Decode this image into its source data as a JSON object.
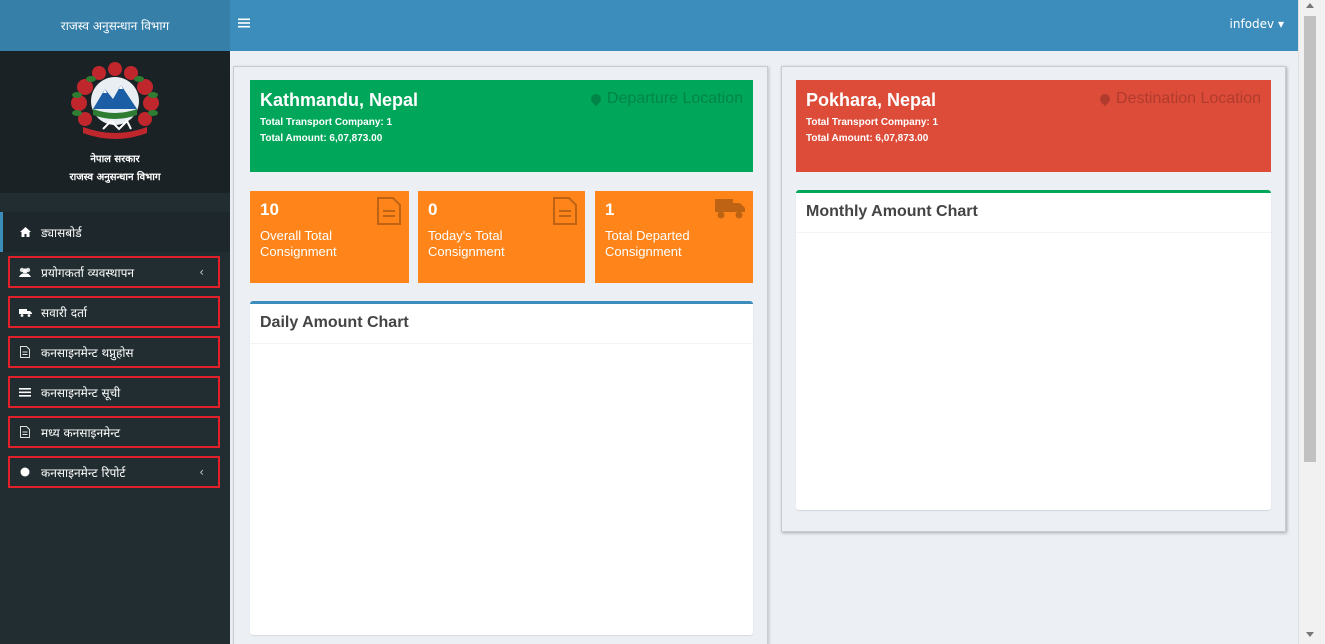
{
  "sidebar": {
    "brand": "राजस्व अनुसन्धान विभाग",
    "logo_line1": "नेपाल सरकार",
    "logo_line2": "राजस्व अनुसन्धान विभाग",
    "items": [
      {
        "label": "ड्यासबोर्ड",
        "icon": "home-icon"
      },
      {
        "label": "प्रयोगकर्ता व्यवस्थापन",
        "icon": "users-icon"
      },
      {
        "label": "सवारी दर्ता",
        "icon": "truck-icon"
      },
      {
        "label": "कनसाइनमेन्ट थप्नुहोस",
        "icon": "file-icon"
      },
      {
        "label": "कनसाइनमेन्ट सूची",
        "icon": "list-icon"
      },
      {
        "label": "मध्य कनसाइनमेन्ट",
        "icon": "file-icon"
      },
      {
        "label": "कनसाइनमेन्ट रिपोर्ट",
        "icon": "circle-icon"
      }
    ]
  },
  "navbar": {
    "user": "infodev ▾"
  },
  "departure": {
    "city": "Kathmandu, Nepal",
    "label": "Departure Location",
    "companies": "Total Transport Company: 1",
    "amount": "Total Amount: 6,07,873.00",
    "color": "#00a65a"
  },
  "destination": {
    "city": "Pokhara, Nepal",
    "label": "Destination Location",
    "companies": "Total Transport Company: 1",
    "amount": "Total Amount: 6,07,873.00",
    "color": "#dd4b39"
  },
  "stats": [
    {
      "value": "10",
      "label1": "Overall Total",
      "label2": "Consignment",
      "icon": "file-icon"
    },
    {
      "value": "0",
      "label1": "Today's Total",
      "label2": "Consignment",
      "icon": "file-icon"
    },
    {
      "value": "1",
      "label1": "Total Departed",
      "label2": "Consignment",
      "icon": "truck-icon"
    }
  ],
  "daily_chart": {
    "title": "Daily Amount Chart"
  },
  "monthly_chart": {
    "title": "Monthly Amount Chart"
  },
  "colors": {
    "accent": "#3c8dbc",
    "orange": "#ff851b",
    "highlight_border": "#e2202c"
  }
}
